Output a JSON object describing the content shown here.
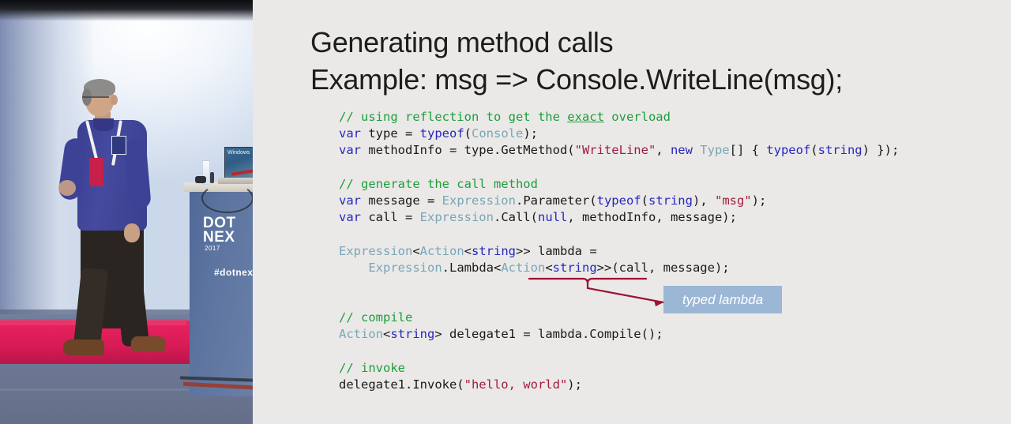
{
  "video": {
    "description": "conference-speaker-video-feed",
    "podium": {
      "line1": "DOT",
      "line2": "NEX",
      "year": "2017",
      "hashtag": "#dotnex"
    },
    "laptop_label": "Windows"
  },
  "slide": {
    "title_line1": "Generating method calls",
    "title_line2": "Example: msg => Console.WriteLine(msg);",
    "background_color": "#EAE9E7",
    "callout": {
      "label": "typed lambda",
      "box_color": "#9CB7D5",
      "text_color": "#FFFFFF",
      "arrow_color": "#9E1133"
    },
    "syntax_colors": {
      "comment": "#1D9E3B",
      "keyword": "#2727BF",
      "type": "#79A5B7",
      "string": "#A31B3C",
      "plain": "#1A1A1A"
    },
    "code": [
      [
        {
          "t": "// using reflection to get the ",
          "c": "cmt"
        },
        {
          "t": "exact",
          "c": "cmt",
          "u": true
        },
        {
          "t": " overload",
          "c": "cmt"
        }
      ],
      [
        {
          "t": "var",
          "c": "kw"
        },
        {
          "t": " type = ",
          "c": "pl"
        },
        {
          "t": "typeof",
          "c": "kw"
        },
        {
          "t": "(",
          "c": "pl"
        },
        {
          "t": "Console",
          "c": "typ"
        },
        {
          "t": ");",
          "c": "pl"
        }
      ],
      [
        {
          "t": "var",
          "c": "kw"
        },
        {
          "t": " methodInfo = type.GetMethod(",
          "c": "pl"
        },
        {
          "t": "\"WriteLine\"",
          "c": "str"
        },
        {
          "t": ", ",
          "c": "pl"
        },
        {
          "t": "new",
          "c": "kw"
        },
        {
          "t": " ",
          "c": "pl"
        },
        {
          "t": "Type",
          "c": "typ"
        },
        {
          "t": "[] { ",
          "c": "pl"
        },
        {
          "t": "typeof",
          "c": "kw"
        },
        {
          "t": "(",
          "c": "pl"
        },
        {
          "t": "string",
          "c": "kw"
        },
        {
          "t": ") });",
          "c": "pl"
        }
      ],
      [],
      [
        {
          "t": "// generate the call method",
          "c": "cmt"
        }
      ],
      [
        {
          "t": "var",
          "c": "kw"
        },
        {
          "t": " message = ",
          "c": "pl"
        },
        {
          "t": "Expression",
          "c": "typ"
        },
        {
          "t": ".Parameter(",
          "c": "pl"
        },
        {
          "t": "typeof",
          "c": "kw"
        },
        {
          "t": "(",
          "c": "pl"
        },
        {
          "t": "string",
          "c": "kw"
        },
        {
          "t": "), ",
          "c": "pl"
        },
        {
          "t": "\"msg\"",
          "c": "str"
        },
        {
          "t": ");",
          "c": "pl"
        }
      ],
      [
        {
          "t": "var",
          "c": "kw"
        },
        {
          "t": " call = ",
          "c": "pl"
        },
        {
          "t": "Expression",
          "c": "typ"
        },
        {
          "t": ".Call(",
          "c": "pl"
        },
        {
          "t": "null",
          "c": "kw"
        },
        {
          "t": ", methodInfo, message);",
          "c": "pl"
        }
      ],
      [],
      [
        {
          "t": "Expression",
          "c": "typ"
        },
        {
          "t": "<",
          "c": "pl"
        },
        {
          "t": "Action",
          "c": "typ"
        },
        {
          "t": "<",
          "c": "pl"
        },
        {
          "t": "string",
          "c": "kw"
        },
        {
          "t": ">> lambda =",
          "c": "pl"
        }
      ],
      [
        {
          "t": "    ",
          "c": "pl"
        },
        {
          "t": "Expression",
          "c": "typ"
        },
        {
          "t": ".Lambda<",
          "c": "pl"
        },
        {
          "t": "Action",
          "c": "typ"
        },
        {
          "t": "<",
          "c": "pl"
        },
        {
          "t": "string",
          "c": "kw"
        },
        {
          "t": ">>(call, message);",
          "c": "pl"
        }
      ],
      [],
      [],
      [
        {
          "t": "// compile",
          "c": "cmt"
        }
      ],
      [
        {
          "t": "Action",
          "c": "typ"
        },
        {
          "t": "<",
          "c": "pl"
        },
        {
          "t": "string",
          "c": "kw"
        },
        {
          "t": "> delegate1 = lambda.Compile();",
          "c": "pl"
        }
      ],
      [],
      [
        {
          "t": "// invoke",
          "c": "cmt"
        }
      ],
      [
        {
          "t": "delegate1.Invoke(",
          "c": "pl"
        },
        {
          "t": "\"hello, world\"",
          "c": "str"
        },
        {
          "t": ");",
          "c": "pl"
        }
      ]
    ]
  }
}
